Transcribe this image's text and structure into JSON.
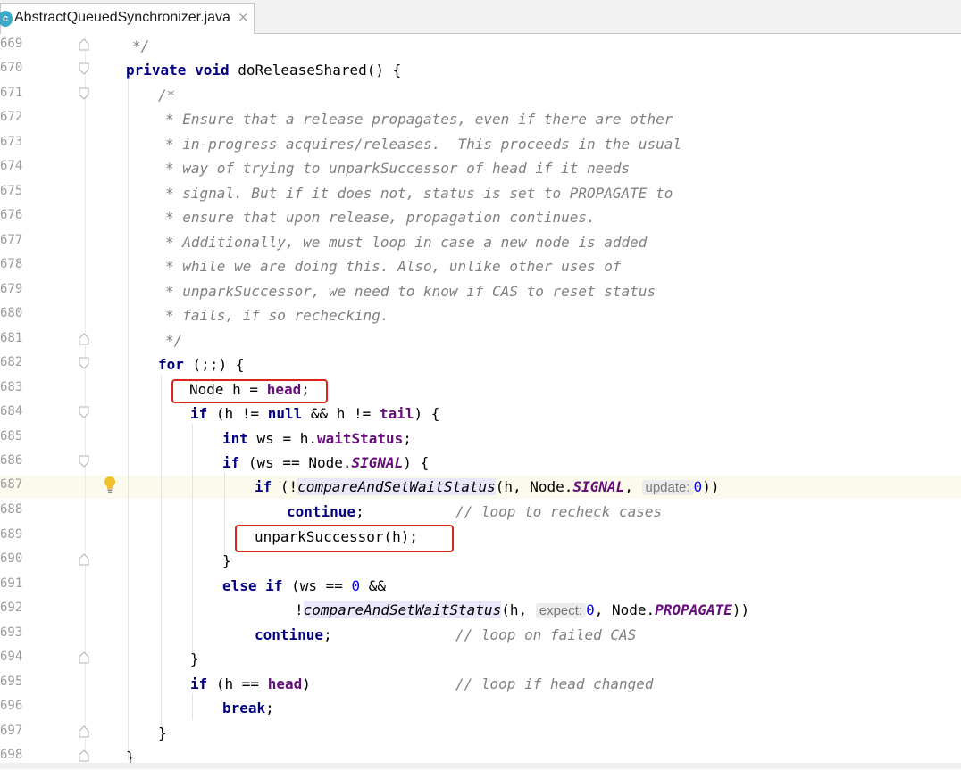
{
  "tab": {
    "icon_letter": "c",
    "title": "AbstractQueuedSynchronizer.java",
    "close": "×"
  },
  "code": {
    "l669": {
      "num": "669",
      "t1": "*/"
    },
    "l670": {
      "num": "670",
      "kw1": "private void",
      "t1": " doReleaseShared() {"
    },
    "l671": {
      "num": "671",
      "t1": "/*"
    },
    "l672": {
      "num": "672",
      "t1": "* Ensure that a release propagates, even if there are other"
    },
    "l673": {
      "num": "673",
      "t1": "* in-progress acquires/releases.  This proceeds in the usual"
    },
    "l674": {
      "num": "674",
      "t1": "* way of trying to unparkSuccessor of head if it needs"
    },
    "l675": {
      "num": "675",
      "t1": "* signal. But if it does not, status is set to PROPAGATE to"
    },
    "l676": {
      "num": "676",
      "t1": "* ensure that upon release, propagation continues."
    },
    "l677": {
      "num": "677",
      "t1": "* Additionally, we must loop in case a new node is added"
    },
    "l678": {
      "num": "678",
      "t1": "* while we are doing this. Also, unlike other uses of"
    },
    "l679": {
      "num": "679",
      "t1": "* unparkSuccessor, we need to know if CAS to reset status"
    },
    "l680": {
      "num": "680",
      "t1": "* fails, if so rechecking."
    },
    "l681": {
      "num": "681",
      "t1": "*/"
    },
    "l682": {
      "num": "682",
      "kw1": "for",
      "t1": " (;;) {"
    },
    "l683": {
      "num": "683",
      "t1": "Node h = ",
      "f1": "head",
      "t2": ";"
    },
    "l684": {
      "num": "684",
      "kw1": "if",
      "t1": " (h != ",
      "kw2": "null",
      "t2": " && h != ",
      "f1": "tail",
      "t3": ") {"
    },
    "l685": {
      "num": "685",
      "kw1": "int",
      "t1": " ws = h.",
      "f1": "waitStatus",
      "t2": ";"
    },
    "l686": {
      "num": "686",
      "kw1": "if",
      "t1": " (ws == Node.",
      "c1": "SIGNAL",
      "t2": ") {"
    },
    "l687": {
      "num": "687",
      "kw1": "if",
      "t1": " (!",
      "m1": "compareAndSetWaitStatus",
      "t2": "(h, Node.",
      "c1": "SIGNAL",
      "t3": ", ",
      "hint": "update:",
      "n1": "0",
      "t4": "))"
    },
    "l688": {
      "num": "688",
      "kw1": "continue",
      "t1": ";",
      "cm1": "// loop to recheck cases"
    },
    "l689": {
      "num": "689",
      "t1": "unparkSuccessor(h);"
    },
    "l690": {
      "num": "690",
      "t1": "}"
    },
    "l691": {
      "num": "691",
      "kw1": "else if",
      "t1": " (ws == ",
      "n1": "0",
      "t2": " &&"
    },
    "l692": {
      "num": "692",
      "t1": "!",
      "m1": "compareAndSetWaitStatus",
      "t2": "(h, ",
      "hint": "expect:",
      "n1": "0",
      "t3": ", Node.",
      "c1": "PROPAGATE",
      "t4": "))"
    },
    "l693": {
      "num": "693",
      "kw1": "continue",
      "t1": ";",
      "cm1": "// loop on failed CAS"
    },
    "l694": {
      "num": "694",
      "t1": "}"
    },
    "l695": {
      "num": "695",
      "kw1": "if",
      "t1": " (h == ",
      "f1": "head",
      "t2": ")",
      "cm1": "// loop if head changed"
    },
    "l696": {
      "num": "696",
      "kw1": "break",
      "t1": ";"
    },
    "l697": {
      "num": "697",
      "t1": "}"
    },
    "l698": {
      "num": "698",
      "t1": "}"
    }
  }
}
